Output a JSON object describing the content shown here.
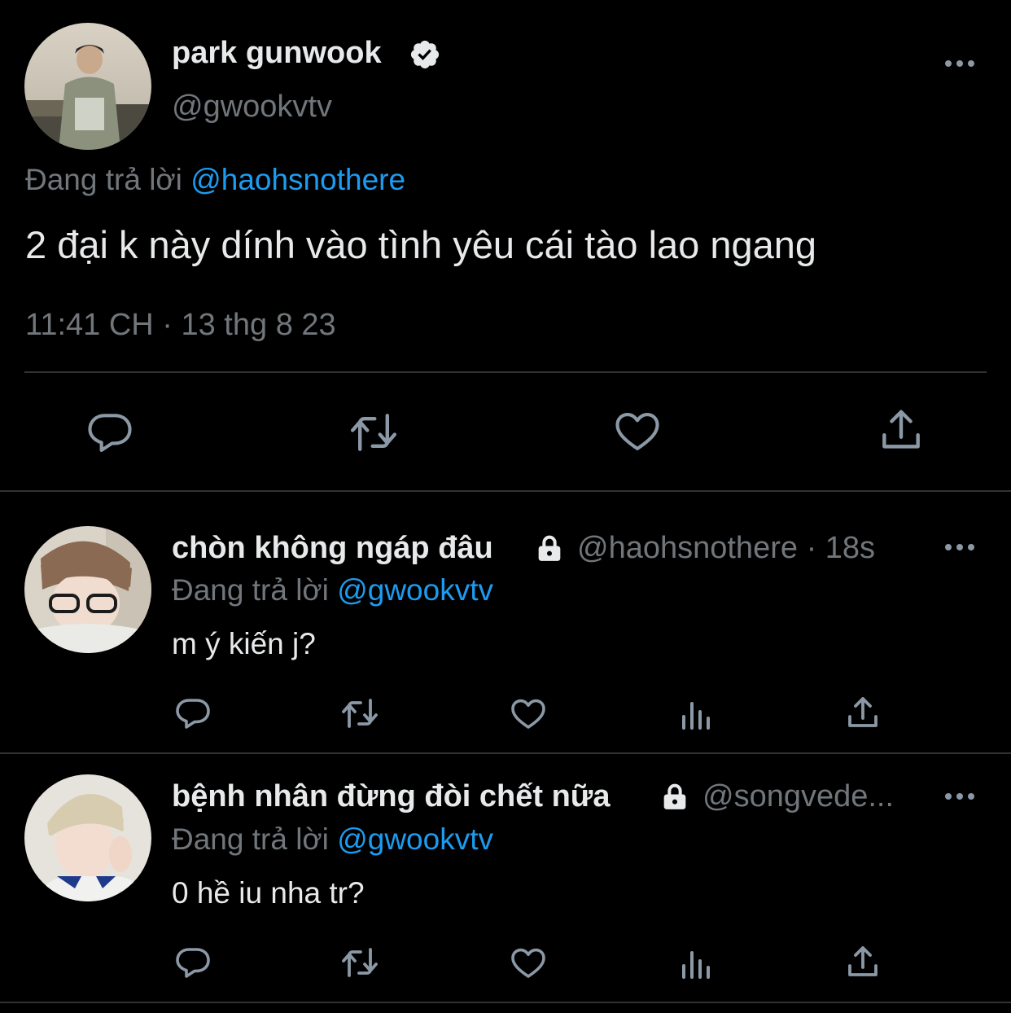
{
  "main_tweet": {
    "display_name": "park gunwook",
    "verified": true,
    "handle": "@gwookvtv",
    "replying_prefix": "Đang trả lời",
    "replying_to": "@haohsnothere",
    "text": "2 đại k này dính vào tình yêu cái tào lao ngang",
    "timestamp": "11:41 CH · 13 thg 8 23",
    "actions": [
      "reply-icon",
      "retweet-icon",
      "like-icon",
      "share-icon"
    ]
  },
  "replies": [
    {
      "display_name": "chòn không ngáp đâu",
      "protected": true,
      "handle": "@haohsnothere",
      "time": "· 18s",
      "replying_prefix": "Đang trả lời",
      "replying_to": "@gwookvtv",
      "text": "m ý kiến j?",
      "actions": [
        "reply-icon",
        "retweet-icon",
        "like-icon",
        "views-icon",
        "share-icon"
      ]
    },
    {
      "display_name": "bệnh nhân đừng đòi chết nữa",
      "protected": true,
      "handle": "@songvede...",
      "time": "",
      "replying_prefix": "Đang trả lời",
      "replying_to": "@gwookvtv",
      "text": "0 hề iu nha tr?",
      "actions": [
        "reply-icon",
        "retweet-icon",
        "like-icon",
        "views-icon",
        "share-icon"
      ]
    }
  ],
  "colors": {
    "background": "#000000",
    "text": "#e7e9ea",
    "secondary": "#71767b",
    "accent": "#1d9bf0",
    "divider": "#2f3336"
  }
}
